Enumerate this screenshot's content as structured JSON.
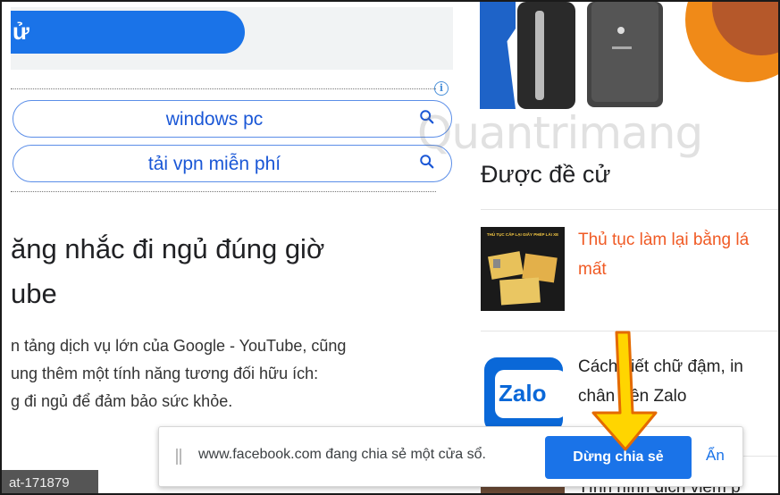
{
  "top": {
    "cta_text": "ử"
  },
  "ads": {
    "info_icon": "i",
    "items": [
      {
        "label": "windows pc"
      },
      {
        "label": "tải vpn miễn phí"
      }
    ]
  },
  "article": {
    "headline_line1": "ăng nhắc đi ngủ đúng giờ",
    "headline_line2": "ube",
    "body_line1": "n tảng dịch vụ lớn của Google - YouTube, cũng",
    "body_line2": "ung thêm một tính năng tương đối hữu ích:",
    "body_line3": "g đi ngủ để đảm bảo sức khỏe."
  },
  "watermark": "Quantrimang",
  "recommended": {
    "title": "Được đề cử",
    "items": [
      {
        "line1": "Thủ tục làm lại bằng lá",
        "line2": "mất",
        "thumb_caption": "THỦ TỤC CẤP LẠI GIẤY PHÉP LÁI XE"
      },
      {
        "line1": "Cách viết chữ đậm, in",
        "line2": "chân trên Zalo",
        "thumb_caption": "Zalo"
      },
      {
        "line1": "Tình hình dịch viêm p"
      }
    ]
  },
  "bottom_tag": "at-171879",
  "share_bar": {
    "message": "www.facebook.com đang chia sẻ một cửa sổ.",
    "stop_label": "Dừng chia sẻ",
    "hide_label": "Ẩn"
  },
  "colors": {
    "accent_blue": "#1a73e8",
    "link_red": "#f05a24",
    "arrow_yellow": "#ffd500"
  }
}
